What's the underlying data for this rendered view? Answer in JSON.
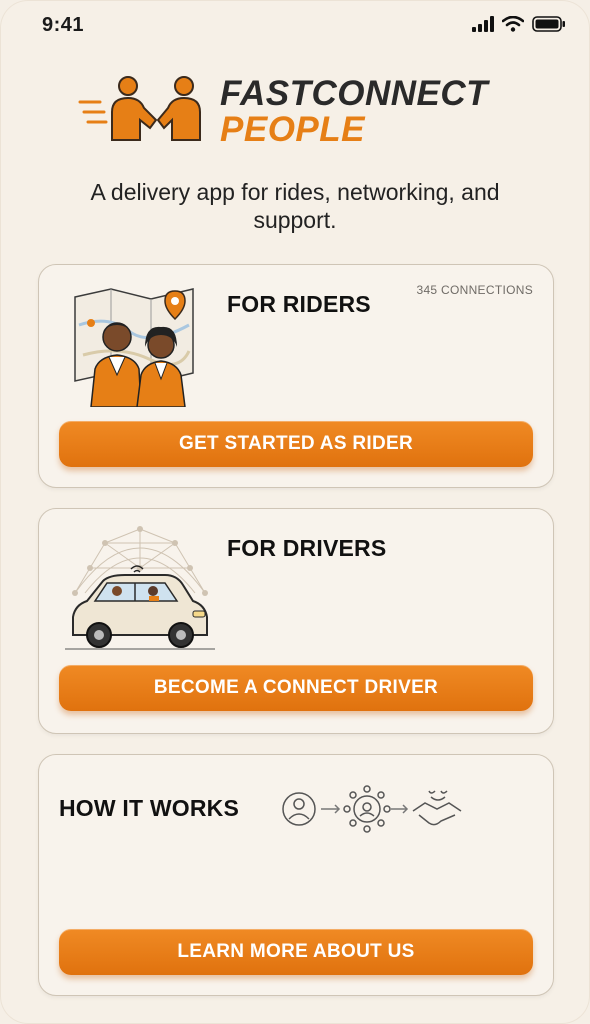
{
  "status_bar": {
    "time": "9:41"
  },
  "brand": {
    "line1": "FASTCONNECT",
    "line2": "PEOPLE"
  },
  "tagline": "A delivery app for rides, networking, and support.",
  "riders_card": {
    "title": "FOR RIDERS",
    "badge": "345 CONNECTIONS",
    "button_label": "GET STARTED AS RIDER"
  },
  "drivers_card": {
    "title": "FOR DRIVERS",
    "button_label": "BECOME A CONNECT DRIVER"
  },
  "how_card": {
    "title": "HOW IT WORKS",
    "button_label": "LEARN MORE ABOUT US"
  },
  "colors": {
    "accent": "#e67f16",
    "background": "#f6f0e7",
    "text": "#1a1a1a"
  },
  "icons": [
    "signal-icon",
    "wifi-icon",
    "battery-icon",
    "handshake-logo-icon",
    "map-pin-icon",
    "car-illustration",
    "user-icon",
    "network-icon",
    "handshake-icon"
  ]
}
